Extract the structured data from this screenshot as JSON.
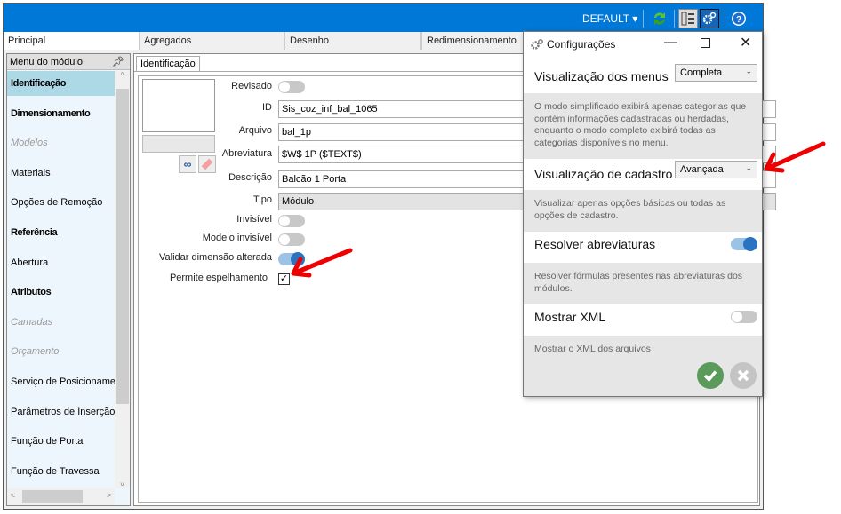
{
  "toolbar": {
    "profile": "DEFAULT",
    "icons": [
      "refresh-icon",
      "layout-icon",
      "settings-icon",
      "help-icon"
    ],
    "accent": "#0078d7"
  },
  "tabs": [
    {
      "label": "Principal",
      "active": true
    },
    {
      "label": "Agregados"
    },
    {
      "label": "Desenho"
    },
    {
      "label": "Redimensionamento"
    }
  ],
  "sidebar": {
    "title": "Menu do módulo",
    "items": [
      {
        "label": "Identificação",
        "style": "sel bold"
      },
      {
        "label": "Dimensionamento",
        "style": "bold"
      },
      {
        "label": "Modelos",
        "style": "dim"
      },
      {
        "label": "Materiais",
        "style": ""
      },
      {
        "label": "Opções de Remoção",
        "style": ""
      },
      {
        "label": "Referência",
        "style": "bold"
      },
      {
        "label": "Abertura",
        "style": ""
      },
      {
        "label": "Atributos",
        "style": "bold"
      },
      {
        "label": "Camadas",
        "style": "dim"
      },
      {
        "label": "Orçamento",
        "style": "dim"
      },
      {
        "label": "Serviço de Posicionamento",
        "style": ""
      },
      {
        "label": "Parâmetros de Inserção",
        "style": ""
      },
      {
        "label": "Função de Porta",
        "style": ""
      },
      {
        "label": "Função de Travessa",
        "style": ""
      }
    ]
  },
  "form": {
    "subtab": "Identificação",
    "revisado": {
      "label": "Revisado",
      "on": false
    },
    "id": {
      "label": "ID",
      "value": "Sis_coz_inf_bal_1065"
    },
    "arquivo": {
      "label": "Arquivo",
      "value": "bal_1p"
    },
    "abreviatura": {
      "label": "Abreviatura",
      "value": "$W$ 1P ($TEXT$)"
    },
    "descricao": {
      "label": "Descrição",
      "value": "Balcão 1 Porta"
    },
    "tipo": {
      "label": "Tipo",
      "value": "Módulo"
    },
    "invisivel": {
      "label": "Invisível",
      "on": false
    },
    "modelo_invisivel": {
      "label": "Modelo invisível",
      "on": false
    },
    "validar": {
      "label": "Validar dimensão alterada",
      "on": true
    },
    "espelhamento": {
      "label": "Permite espelhamento",
      "checked": true
    }
  },
  "dialog": {
    "title": "Configurações",
    "menus": {
      "label": "Visualização dos menus",
      "value": "Completa",
      "desc": "O modo simplificado exibirá apenas categorias que contém informações cadastradas ou herdadas, enquanto o modo completo exibirá todas as categorias disponíveis no menu."
    },
    "cadastro": {
      "label": "Visualização de cadastro",
      "value": "Avançada",
      "desc": "Visualizar apenas opções básicas ou todas as opções de cadastro."
    },
    "abrev": {
      "label": "Resolver abreviaturas",
      "on": true,
      "desc": "Resolver fórmulas presentes nas abreviaturas dos módulos."
    },
    "xml": {
      "label": "Mostrar XML",
      "on": false,
      "desc": "Mostrar o XML dos arquivos"
    },
    "confirm_color": "#5a9a5a",
    "cancel_color": "#c4c4c4"
  }
}
